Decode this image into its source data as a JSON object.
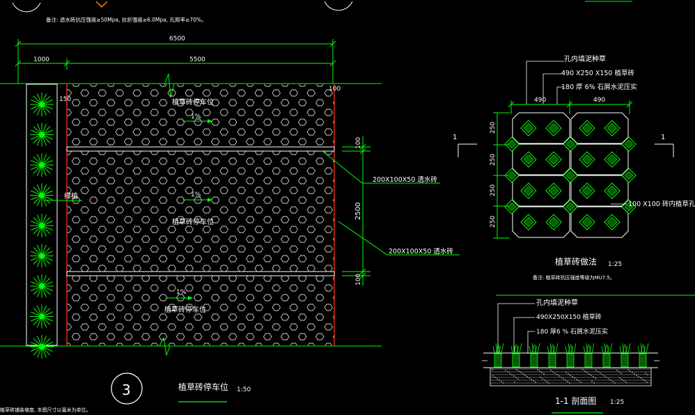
{
  "top_note": "备注: 透水砖抗压强度≥50Mpa, 抗折强度≥6.0Mpa, 孔隙率≥70%。",
  "plan": {
    "dims": {
      "total": "6500",
      "left": "1000",
      "right": "5500"
    },
    "labels": {
      "edge_150": "150",
      "edge_100": "100",
      "greenery": "绿植",
      "bay": "植草砖停车位",
      "slope": "1%",
      "paver_upper": "200X100X50 透水砖",
      "paver_lower": "200X100X50 透水砖",
      "dim_100_top": "100",
      "dim_2500": "2500",
      "dim_100_bottom": "100"
    },
    "title": {
      "number": "3",
      "text": "植草砖停车位",
      "scale": "1:50"
    },
    "footnote": "植草砖铺装坡度, 本图尺寸以毫米为单位。"
  },
  "detail": {
    "layers": [
      "孔内填泥种草",
      "490 X250 X150  植草砖",
      "180  厚 6% 石屑水泥压实"
    ],
    "dims_top": [
      "490",
      "490"
    ],
    "dims_side": [
      "250",
      "250",
      "250",
      "250"
    ],
    "section_marks": [
      "1",
      "1"
    ],
    "hole_note": "100 X100  砖内植草孔",
    "title": "植草砖做法",
    "scale": "1:25",
    "note": "备注: 植草砖抗压强度等级为MU7.5。"
  },
  "section": {
    "layers": [
      "孔内填泥种草",
      "490X250X150        植草砖",
      "180  厚6 % 石屑水泥压实"
    ],
    "title": "1-1 剖面图",
    "scale": "1:25"
  },
  "colors": {
    "green": "#00ff00",
    "grid": "#d2d2d2",
    "red": "#ff3020",
    "white": "#ffffff"
  }
}
